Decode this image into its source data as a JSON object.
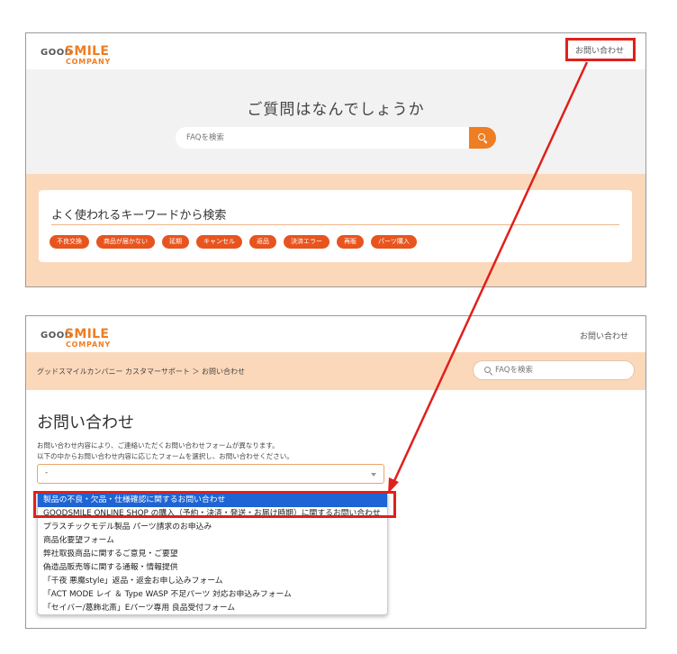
{
  "logo": {
    "good": "GOOD",
    "smile": "SMILE",
    "company": "COMPANY"
  },
  "top": {
    "contact_link": "お問い合わせ",
    "hero_title": "ご質問はなんでしょうか",
    "faq_placeholder": "FAQを検索",
    "keywords_title": "よく使われるキーワードから検索",
    "keywords": [
      "不良交換",
      "商品が届かない",
      "延期",
      "キャンセル",
      "返品",
      "決済エラー",
      "再販",
      "パーツ購入"
    ]
  },
  "bottom": {
    "contact_link": "お問い合わせ",
    "breadcrumb": "グッドスマイルカンパニー カスタマーサポート ＞ お問い合わせ",
    "faq_placeholder": "FAQを検索",
    "page_title": "お問い合わせ",
    "desc_line1": "お問い合わせ内容により、ご連絡いただくお問い合わせフォームが異なります。",
    "desc_line2": "以下の中からお問い合わせ内容に応じたフォームを選択し、お問い合わせください。",
    "select_value": "-",
    "options": [
      "製品の不良・欠品・仕様確認に関するお問い合わせ",
      "GOODSMILE ONLINE SHOP の購入（予約・決済・発送・お届け時期）に関するお問い合わせ",
      "プラスチックモデル製品 パーツ請求のお申込み",
      "商品化要望フォーム",
      "弊社取扱商品に関するご意見・ご要望",
      "偽造品販売等に関する通報・情報提供",
      "「千夜 悪魔style」返品・返金お申し込みフォーム",
      "「ACT MODE レイ ＆ Type WASP 不足パーツ 対応お申込みフォーム",
      "「セイバー/葛飾北斎」Eパーツ専用 良品受付フォーム"
    ],
    "selected_index": 0
  },
  "colors": {
    "accent": "#ef7d22",
    "tag": "#e8541e",
    "peach": "#fcd8bb",
    "highlight": "#e0201b",
    "selected": "#1e64d4"
  }
}
